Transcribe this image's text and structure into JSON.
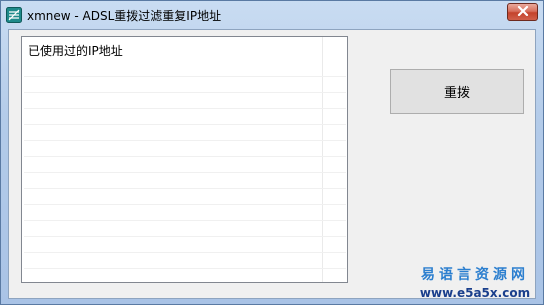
{
  "window": {
    "title": "xmnew - ADSL重拨过滤重复IP地址",
    "app_icon": "app-icon",
    "close_icon": "close-icon"
  },
  "list": {
    "column_header": "已使用过的IP地址",
    "rows": []
  },
  "buttons": {
    "redial_label": "重拨"
  },
  "watermark": {
    "cn": "易语言资源网",
    "url": "www.e5a5x.com"
  },
  "colors": {
    "title_bar": "#b3cbe9",
    "close_button": "#c4432c",
    "watermark_blue": "#2c7fcf"
  }
}
